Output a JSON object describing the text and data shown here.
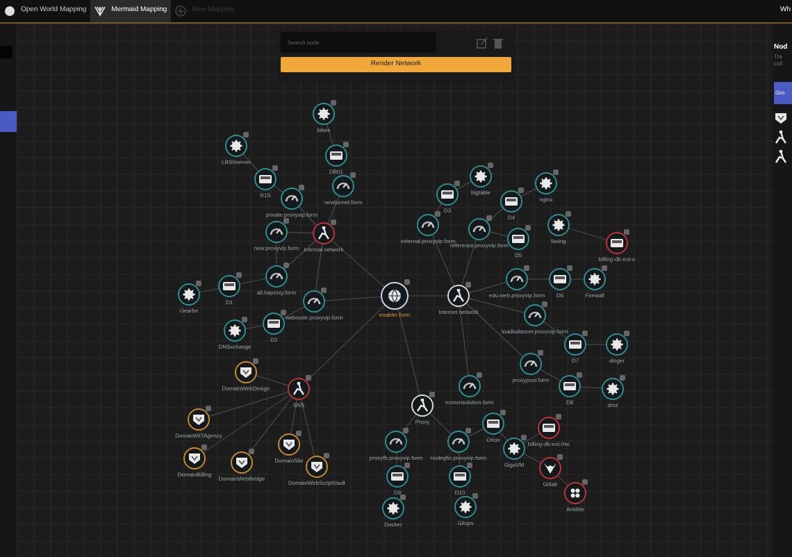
{
  "tabs": [
    {
      "label": "Open World Mapping",
      "selected": false
    },
    {
      "label": "Mermaid Mapping",
      "selected": true
    },
    {
      "label": "New Mapping",
      "selected": false
    }
  ],
  "user_label": "Wh",
  "toolbar": {
    "search": {
      "placeholder": "Search node"
    },
    "button": "Render Network"
  },
  "right_panel": {
    "title": "Nod",
    "lines": [
      "Tra",
      "coll"
    ],
    "button": "Gro"
  },
  "nodes": [
    {
      "label": "bikes",
      "kind": "gear",
      "color": "#2f8f91"
    },
    {
      "label": "LBS0server",
      "kind": "gear",
      "color": "#2f8f91"
    },
    {
      "label": "DB01",
      "kind": "server",
      "color": "#2f8f91"
    },
    {
      "label": "bigtable",
      "kind": "gear",
      "color": "#2f8f91"
    },
    {
      "label": "R1S",
      "kind": "server",
      "color": "#2f8f91"
    },
    {
      "label": "nginx",
      "kind": "gear",
      "color": "#2f8f91"
    },
    {
      "label": "newtunnel.form",
      "kind": "gauge",
      "color": "#2f8f91"
    },
    {
      "label": "D3",
      "kind": "server",
      "color": "#2f8f91"
    },
    {
      "label": "private.proxyvip.form",
      "kind": "gauge",
      "color": "#2f8f91"
    },
    {
      "label": "D4",
      "kind": "server",
      "color": "#2f8f91"
    },
    {
      "label": "external.proxyvip.form",
      "kind": "gauge",
      "color": "#2f8f91"
    },
    {
      "label": "faxing",
      "kind": "gear",
      "color": "#2f8f91"
    },
    {
      "label": "reference.proxyvip.form",
      "kind": "gauge",
      "color": "#2f8f91"
    },
    {
      "label": "new.proxyvip.form",
      "kind": "gauge",
      "color": "#2f8f91"
    },
    {
      "label": "Internal network",
      "kind": "route",
      "color": "#c0333a"
    },
    {
      "label": "D5",
      "kind": "server",
      "color": "#2f8f91"
    },
    {
      "label": "billing-db-ext-o",
      "kind": "server",
      "color": "#c0333a"
    },
    {
      "label": "all.haproxy.form",
      "kind": "gauge",
      "color": "#2f8f91"
    },
    {
      "label": "edu.web.proxyvip.form",
      "kind": "gauge",
      "color": "#2f8f91"
    },
    {
      "label": "D6",
      "kind": "server",
      "color": "#2f8f91"
    },
    {
      "label": "Firewall",
      "kind": "gear",
      "color": "#2f8f91"
    },
    {
      "label": "D1",
      "kind": "server",
      "color": "#2f8f91"
    },
    {
      "label": "Gearbe",
      "kind": "gear",
      "color": "#2f8f91"
    },
    {
      "label": "enabler.form",
      "kind": "globe",
      "color": "#c9d6ea"
    },
    {
      "label": "Internet network",
      "kind": "route",
      "color": "#d8d8d8"
    },
    {
      "label": "webnode.proxyvip.form",
      "kind": "gauge",
      "color": "#2f8f91"
    },
    {
      "label": "loadbalancer.proxyvip.form",
      "kind": "gauge",
      "color": "#2f8f91"
    },
    {
      "label": "D2",
      "kind": "server",
      "color": "#2f8f91"
    },
    {
      "label": "DNSxchange",
      "kind": "gear",
      "color": "#2f8f91"
    },
    {
      "label": "D7",
      "kind": "server",
      "color": "#2f8f91"
    },
    {
      "label": "dinger",
      "kind": "gear",
      "color": "#2f8f91"
    },
    {
      "label": "proxypool.form",
      "kind": "gauge",
      "color": "#2f8f91"
    },
    {
      "label": "DomainWebDesign",
      "kind": "shield",
      "color": "#c98a2e"
    },
    {
      "label": "ecmonsolution.form",
      "kind": "gauge",
      "color": "#2f8f91"
    },
    {
      "label": "D8",
      "kind": "server",
      "color": "#2f8f91"
    },
    {
      "label": "SNS",
      "kind": "route",
      "color": "#c0333a"
    },
    {
      "label": "dmz",
      "kind": "gear",
      "color": "#2f8f91"
    },
    {
      "label": "Proxy",
      "kind": "route",
      "color": "#d8d8d8"
    },
    {
      "label": "DomainMITAgency",
      "kind": "shield",
      "color": "#c98a2e"
    },
    {
      "label": "Orion",
      "kind": "server",
      "color": "#2f8f91"
    },
    {
      "label": "billing-db-ext-0sc",
      "kind": "server",
      "color": "#c0333a"
    },
    {
      "label": "DomainSite",
      "kind": "shield",
      "color": "#c98a2e"
    },
    {
      "label": "proxyfb.proxyvip.form",
      "kind": "gauge",
      "color": "#2f8f91"
    },
    {
      "label": "nodegfix.proxyvip.form",
      "kind": "gauge",
      "color": "#2f8f91"
    },
    {
      "label": "GigaVM",
      "kind": "gear",
      "color": "#2f8f91"
    },
    {
      "label": "DomainBilling",
      "kind": "shield",
      "color": "#c98a2e"
    },
    {
      "label": "DomainWebBridge",
      "kind": "shield",
      "color": "#c98a2e"
    },
    {
      "label": "DomainWebScriptVault",
      "kind": "shield",
      "color": "#c98a2e"
    },
    {
      "label": "Gitlab",
      "kind": "fox",
      "color": "#c0333a"
    },
    {
      "label": "D9",
      "kind": "server",
      "color": "#2f8f91"
    },
    {
      "label": "D10",
      "kind": "server",
      "color": "#2f8f91"
    },
    {
      "label": "Ansible",
      "kind": "cluster",
      "color": "#c0333a"
    },
    {
      "label": "Gitops",
      "kind": "gear",
      "color": "#2f8f91"
    },
    {
      "label": "Docker",
      "kind": "gear",
      "color": "#2f8f91"
    }
  ]
}
